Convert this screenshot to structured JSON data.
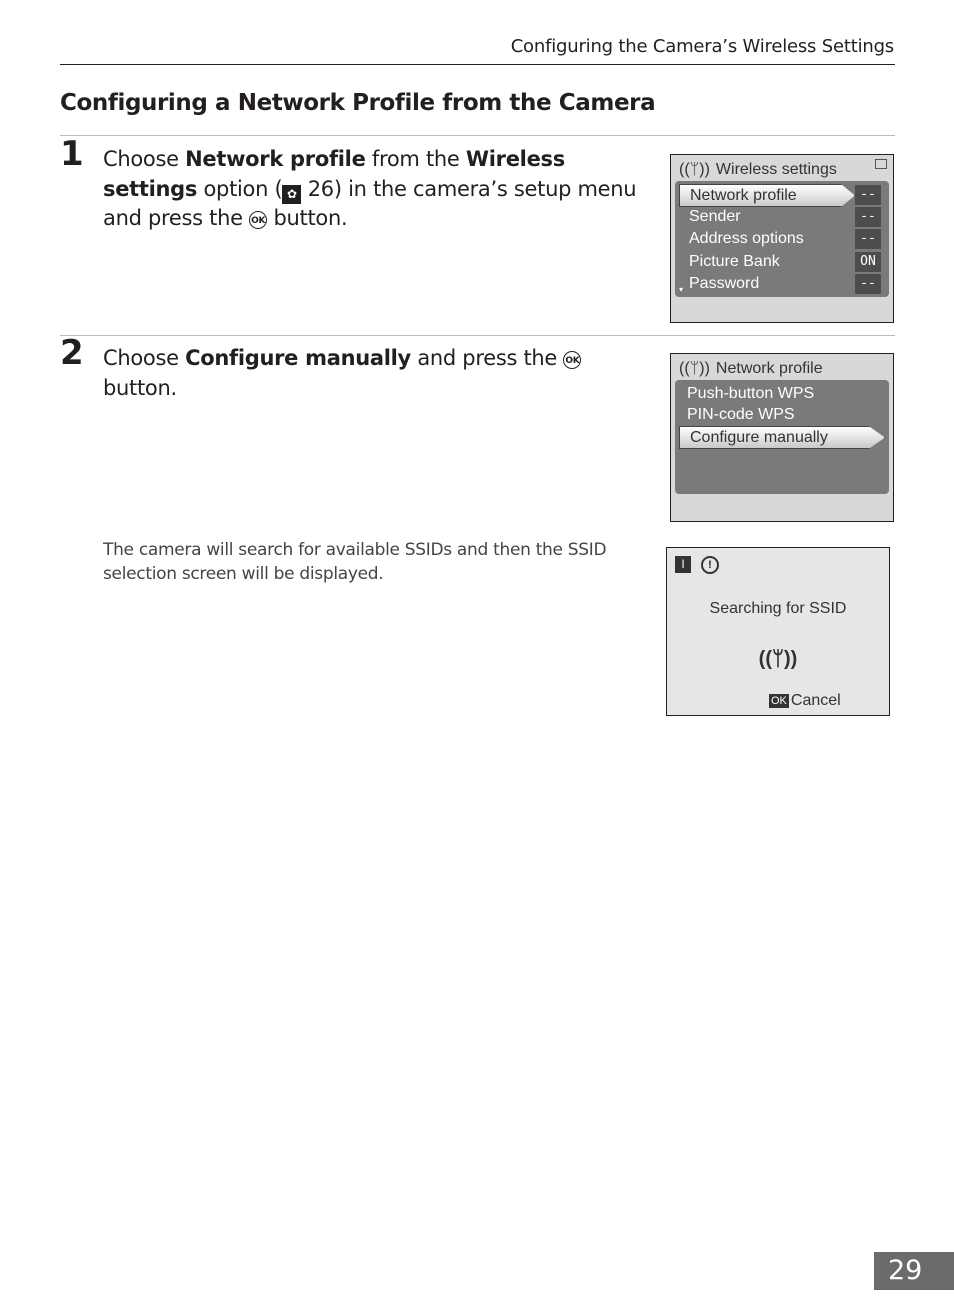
{
  "header": {
    "running_title": "Configuring the Camera’s Wireless Settings"
  },
  "section": {
    "title": "Configuring a Network Profile from the Camera"
  },
  "steps": [
    {
      "number": "1",
      "parts": {
        "t1": "Choose ",
        "b1": "Network profile",
        "t2": " from the ",
        "b2": "Wireless settings",
        "t3": " option (",
        "ref_page": "26",
        "t4": ") in the camera’s setup menu and press the ",
        "ok_glyph": "OK",
        "t5": " button."
      }
    },
    {
      "number": "2",
      "parts": {
        "t1": "Choose ",
        "b1": "Configure manually",
        "t2": " and press the ",
        "ok_glyph": "OK",
        "t3": " button."
      },
      "note": "The camera will search for available SSIDs and then the SSID selection screen will be displayed."
    }
  ],
  "screens": {
    "wireless_settings": {
      "title": "Wireless settings",
      "items": [
        {
          "label": "Network profile",
          "value": "--",
          "selected": true
        },
        {
          "label": "Sender",
          "value": "--"
        },
        {
          "label": "Address options",
          "value": "--"
        },
        {
          "label": "Picture Bank",
          "value": "ON"
        },
        {
          "label": "Password",
          "value": "--"
        }
      ]
    },
    "network_profile": {
      "title": "Network profile",
      "items": [
        {
          "label": "Push-button WPS"
        },
        {
          "label": "PIN-code WPS"
        },
        {
          "label": "Configure manually",
          "selected": true
        }
      ]
    },
    "searching": {
      "message": "Searching for SSID",
      "ok_label": "OK",
      "cancel_label": "Cancel"
    }
  },
  "footer": {
    "page_number": "29"
  }
}
